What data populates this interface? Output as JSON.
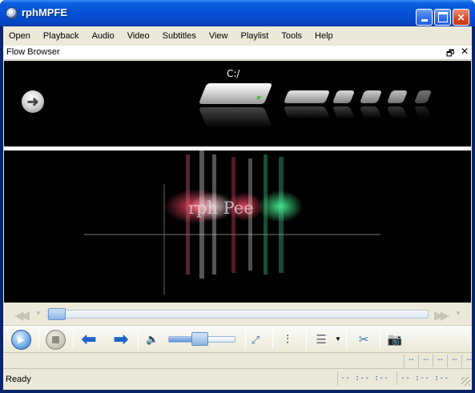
{
  "window": {
    "title": "rphMPFE"
  },
  "menu": {
    "items": [
      "Open",
      "Playback",
      "Audio",
      "Video",
      "Subtitles",
      "View",
      "Playlist",
      "Tools",
      "Help"
    ]
  },
  "flow_browser": {
    "title": "Flow Browser",
    "restore_icon": "restore-icon",
    "close_icon": "close-icon",
    "path": "C:/",
    "back_icon": "back-arrow-icon",
    "item_icon": "hard-drive-icon"
  },
  "video": {
    "logo_text": "rph Pee"
  },
  "seek": {
    "position_fraction": 0.0
  },
  "toolbar": {
    "play_icon": "play-icon",
    "stop_icon": "stop-icon",
    "prev_icon": "prev-arrow-icon",
    "next_icon": "next-arrow-icon",
    "volume_icon": "speaker-icon",
    "volume_level": 0.45,
    "fullscreen_icon": "fullscreen-icon",
    "equalizer_icon": "equalizer-icon",
    "playlist_icon": "playlist-icon",
    "cut_icon": "scissors-icon",
    "snapshot_icon": "camera-icon"
  },
  "info": {
    "cells": [
      "--",
      "--",
      "--",
      "--",
      "--"
    ]
  },
  "status": {
    "text": "Ready",
    "elapsed": "-- :-- :--",
    "total": "-- :-- :--"
  },
  "colors": {
    "title_bar": "#0551d6",
    "accent_blue": "#1f63c9",
    "status_text": "#3355aa"
  }
}
